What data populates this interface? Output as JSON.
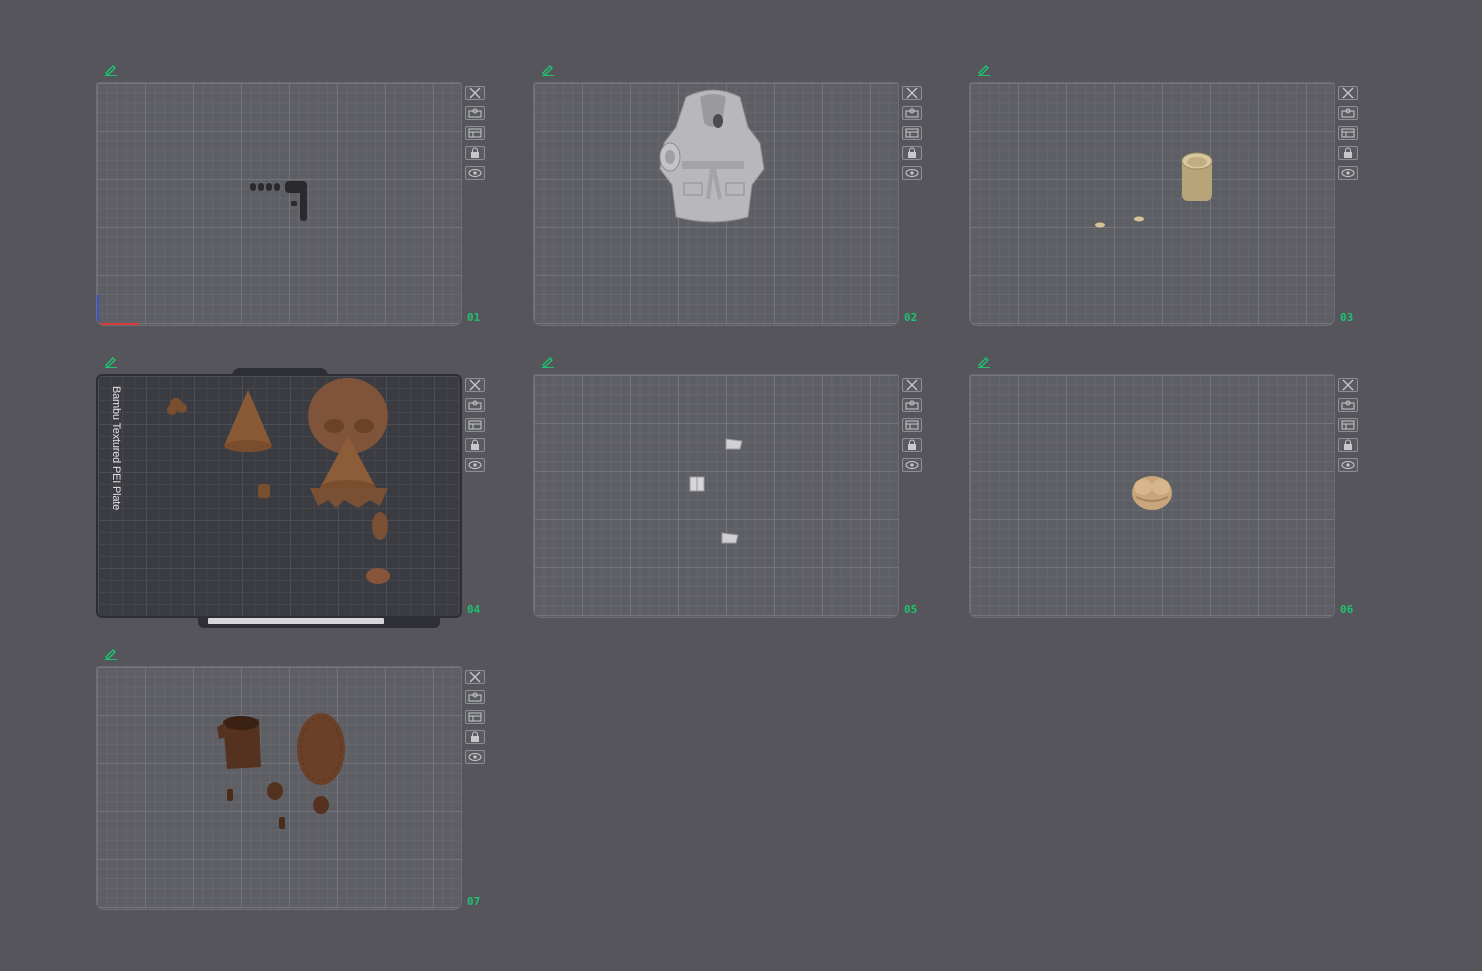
{
  "plates": [
    {
      "number": "01",
      "textured": false
    },
    {
      "number": "02",
      "textured": false
    },
    {
      "number": "03",
      "textured": false
    },
    {
      "number": "04",
      "textured": true,
      "plate_type_label": "Bambu Textured PEI Plate"
    },
    {
      "number": "05",
      "textured": false
    },
    {
      "number": "06",
      "textured": false
    },
    {
      "number": "07",
      "textured": false
    }
  ],
  "plate_tools": [
    "close-icon",
    "arrange-icon",
    "orient-icon",
    "lock-icon",
    "eye-icon"
  ],
  "colors": {
    "background": "#55555b",
    "bed": "#5e5f65",
    "textured_bed": "#3b3c42",
    "plate_number": "#1ec36e",
    "edit_icon": "#1ec36e"
  }
}
